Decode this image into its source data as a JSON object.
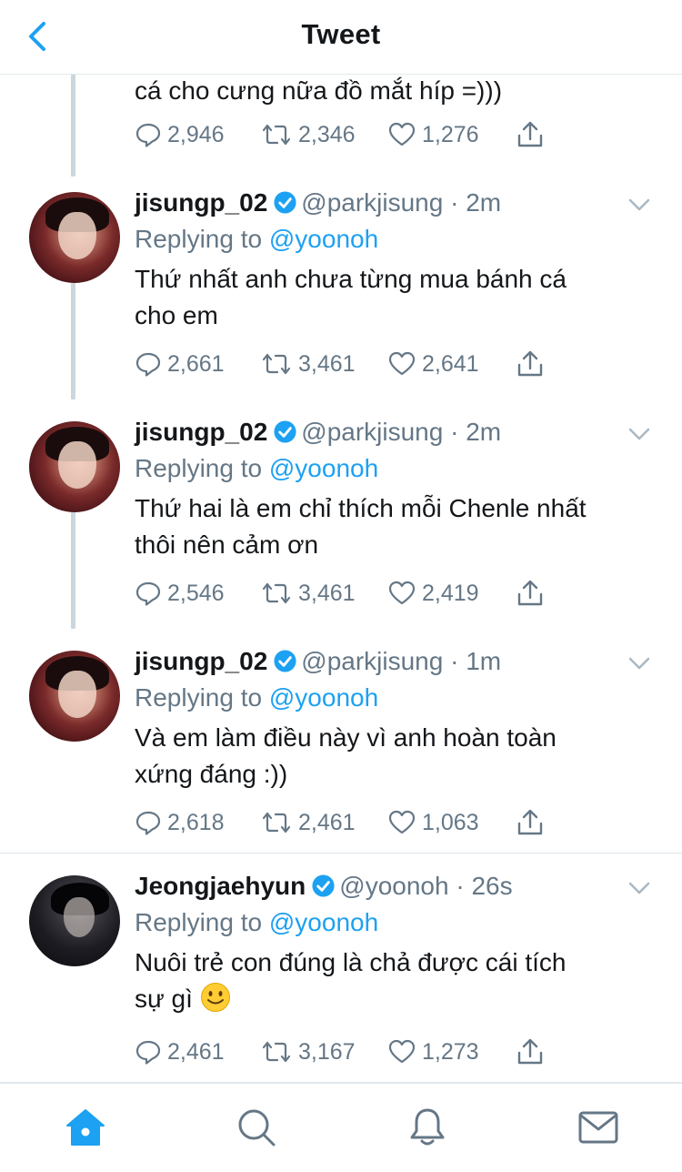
{
  "nav": {
    "title": "Tweet",
    "back_icon": "chevron-left-icon"
  },
  "colors": {
    "accent": "#1da1f2",
    "muted": "#657786",
    "text": "#14171a",
    "thread": "#ccd6dd"
  },
  "partial_tweet": {
    "text": "cá cho cưng nữa đồ mắt híp =)))",
    "replies": "2,946",
    "retweets": "2,346",
    "likes": "1,276"
  },
  "tweets": [
    {
      "name": "jisungp_02",
      "handle": "@parkjisung",
      "time": "· 2m",
      "replying_label": "Replying to",
      "replying_to": "@yoonoh",
      "text_line1": "Thứ nhất anh chưa từng mua bánh cá",
      "text_line2": "cho em",
      "replies": "2,661",
      "retweets": "3,461",
      "likes": "2,641"
    },
    {
      "name": "jisungp_02",
      "handle": "@parkjisung",
      "time": "· 2m",
      "replying_label": "Replying to",
      "replying_to": "@yoonoh",
      "text_line1": "Thứ hai là em chỉ thích mỗi Chenle nhất",
      "text_line2": "thôi nên cảm ơn",
      "replies": "2,546",
      "retweets": "3,461",
      "likes": "2,419"
    },
    {
      "name": "jisungp_02",
      "handle": "@parkjisung",
      "time": "· 1m",
      "replying_label": "Replying to",
      "replying_to": "@yoonoh",
      "text_line1": "Và em làm điều này vì anh hoàn toàn",
      "text_line2": "xứng đáng :))",
      "replies": "2,618",
      "retweets": "2,461",
      "likes": "1,063"
    },
    {
      "name": "Jeongjaehyun",
      "handle": "@yoonoh",
      "time": "· 26s",
      "replying_label": "Replying to",
      "replying_to": "@yoonoh",
      "text_line1": "Nuôi trẻ con đúng là chả được cái tích",
      "text_line2": "sự gì",
      "emoji": "slightly-smiling-face",
      "replies": "2,461",
      "retweets": "3,167",
      "likes": "1,273"
    }
  ],
  "tabbar": {
    "items": [
      "home-icon",
      "search-icon",
      "notifications-bell-icon",
      "messages-envelope-icon"
    ],
    "active": "home-icon"
  }
}
